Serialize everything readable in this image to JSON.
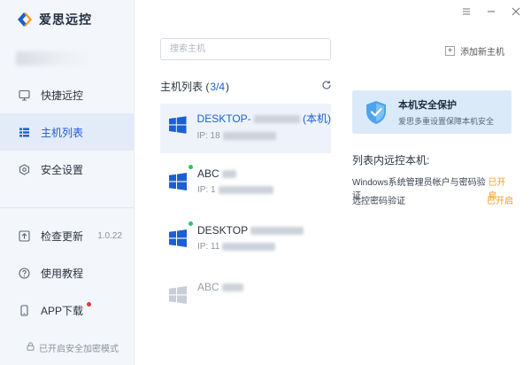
{
  "app": {
    "name": "爱思远控"
  },
  "sidebar": {
    "items": [
      {
        "label": "快捷远控"
      },
      {
        "label": "主机列表"
      },
      {
        "label": "安全设置"
      }
    ],
    "bottom_items": [
      {
        "label": "检查更新",
        "version": "1.0.22"
      },
      {
        "label": "使用教程"
      },
      {
        "label": "APP下载"
      }
    ],
    "footer_mode": "已开启安全加密模式"
  },
  "search": {
    "placeholder": "搜索主机"
  },
  "host_list": {
    "title_prefix": "主机列表 (",
    "count": "3/4",
    "title_suffix": ")",
    "hosts": [
      {
        "name": "DESKTOP-",
        "tag": "(本机)",
        "ip_prefix": "IP: 18",
        "status": "local"
      },
      {
        "name": "ABC",
        "ip_prefix": "IP: 1",
        "status": "online"
      },
      {
        "name": "DESKTOP",
        "ip_prefix": "IP: 11",
        "status": "online"
      },
      {
        "name": "ABC",
        "status": "offline"
      }
    ]
  },
  "right": {
    "add_host": "添加新主机",
    "security": {
      "title": "本机安全保护",
      "subtitle": "爱思多重设置保障本机安全"
    },
    "remote_title": "列表内远控本机:",
    "rows": [
      {
        "label": "Windows系统管理员帐户与密码验证",
        "status": "已开启"
      },
      {
        "label": "远控密码验证",
        "status": "已开启"
      }
    ]
  },
  "colors": {
    "accent": "#1b5fd1",
    "online": "#2cc26b",
    "warning": "#f39b1c",
    "badge": "#e23c3c"
  }
}
